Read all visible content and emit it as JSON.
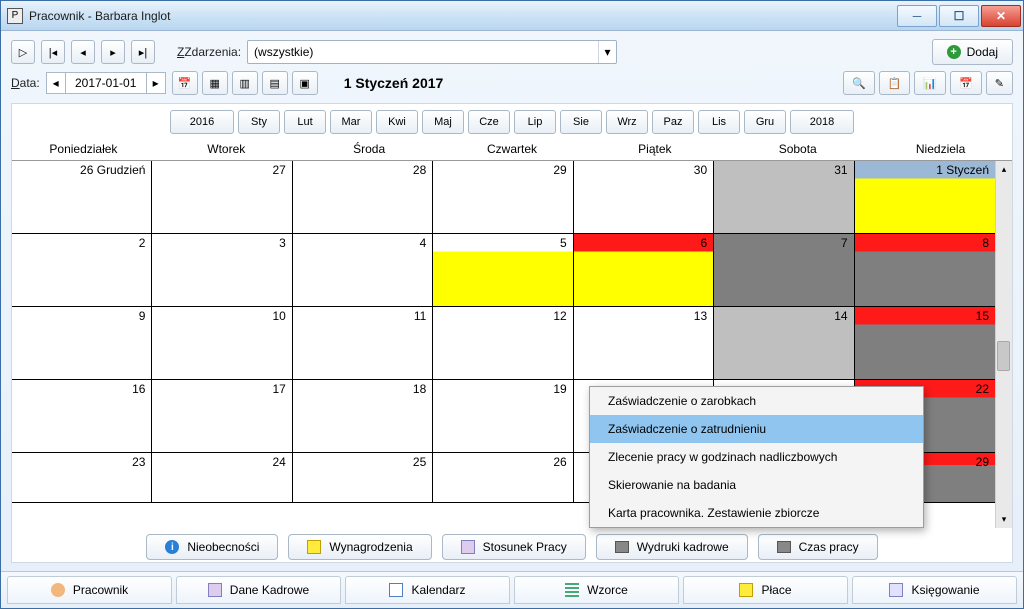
{
  "window": {
    "title": "Pracownik - Barbara Inglot"
  },
  "toolbar1": {
    "zdarzenia_label": "Zdarzenia:",
    "filter_value": "(wszystkie)",
    "dodaj_label": "Dodaj"
  },
  "toolbar2": {
    "data_label": "Data:",
    "date_value": "2017-01-01",
    "month_title": "1 Styczeń 2017"
  },
  "nav": {
    "prev_year": "2016",
    "next_year": "2018",
    "months": [
      "Sty",
      "Lut",
      "Mar",
      "Kwi",
      "Maj",
      "Cze",
      "Lip",
      "Sie",
      "Wrz",
      "Paz",
      "Lis",
      "Gru"
    ]
  },
  "dayheaders": [
    "Poniedziałek",
    "Wtorek",
    "Środa",
    "Czwartek",
    "Piątek",
    "Sobota",
    "Niedziela"
  ],
  "weeks": [
    [
      {
        "label": "26 Grudzień",
        "bg": "#fff"
      },
      {
        "label": "27",
        "bg": "#fff"
      },
      {
        "label": "28",
        "bg": "#fff"
      },
      {
        "label": "29",
        "bg": "#fff"
      },
      {
        "label": "30",
        "bg": "#fff"
      },
      {
        "label": "31",
        "bg": "#bfbfbf"
      },
      {
        "label": "1 Styczeń",
        "bg_top": "#9bb9d6",
        "bg_bottom": "#ffff00"
      }
    ],
    [
      {
        "label": "2",
        "bg": "#fff"
      },
      {
        "label": "3",
        "bg": "#fff"
      },
      {
        "label": "4",
        "bg": "#fff"
      },
      {
        "label": "5",
        "bg_top": "#fff",
        "bg_bottom": "#ffff00"
      },
      {
        "label": "6",
        "bg_top": "#ff1a1a",
        "bg_bottom": "#ffff00",
        "fg": "#000"
      },
      {
        "label": "7",
        "bg": "#7f7f7f",
        "fg": "#000"
      },
      {
        "label": "8",
        "bg_top": "#ff1a1a",
        "bg_bottom": "#7f7f7f",
        "fg": "#000"
      }
    ],
    [
      {
        "label": "9",
        "bg": "#fff"
      },
      {
        "label": "10",
        "bg": "#fff"
      },
      {
        "label": "11",
        "bg": "#fff"
      },
      {
        "label": "12",
        "bg": "#fff"
      },
      {
        "label": "13",
        "bg": "#fff"
      },
      {
        "label": "14",
        "bg": "#bfbfbf"
      },
      {
        "label": "15",
        "bg_top": "#ff1a1a",
        "bg_bottom": "#7f7f7f",
        "fg": "#000"
      }
    ],
    [
      {
        "label": "16",
        "bg": "#fff"
      },
      {
        "label": "17",
        "bg": "#fff"
      },
      {
        "label": "18",
        "bg": "#fff"
      },
      {
        "label": "19",
        "bg": "#fff"
      },
      {
        "label": "",
        "bg": "#fff"
      },
      {
        "label": "",
        "bg": "#fff"
      },
      {
        "label": "22",
        "bg_top": "#ff1a1a",
        "bg_bottom": "#7f7f7f",
        "fg": "#000"
      }
    ],
    [
      {
        "label": "23",
        "bg": "#fff"
      },
      {
        "label": "24",
        "bg": "#fff"
      },
      {
        "label": "25",
        "bg": "#fff"
      },
      {
        "label": "26",
        "bg": "#fff"
      },
      {
        "label": "",
        "bg": "#fff"
      },
      {
        "label": "",
        "bg": "#fff"
      },
      {
        "label": "29",
        "bg_top": "#ff1a1a",
        "bg_bottom": "#7f7f7f",
        "fg": "#000"
      }
    ]
  ],
  "context_menu": {
    "items": [
      "Zaświadczenie o zarobkach",
      "Zaświadczenie o zatrudnieniu",
      "Zlecenie pracy w godzinach nadliczbowych",
      "Skierowanie na badania",
      "Karta pracownika. Zestawienie zbiorcze"
    ],
    "highlight_index": 1
  },
  "bottom_buttons": [
    "Nieobecności",
    "Wynagrodzenia",
    "Stosunek Pracy",
    "Wydruki kadrowe",
    "Czas pracy"
  ],
  "main_tabs": [
    "Pracownik",
    "Dane Kadrowe",
    "Kalendarz",
    "Wzorce",
    "Płace",
    "Księgowanie"
  ]
}
